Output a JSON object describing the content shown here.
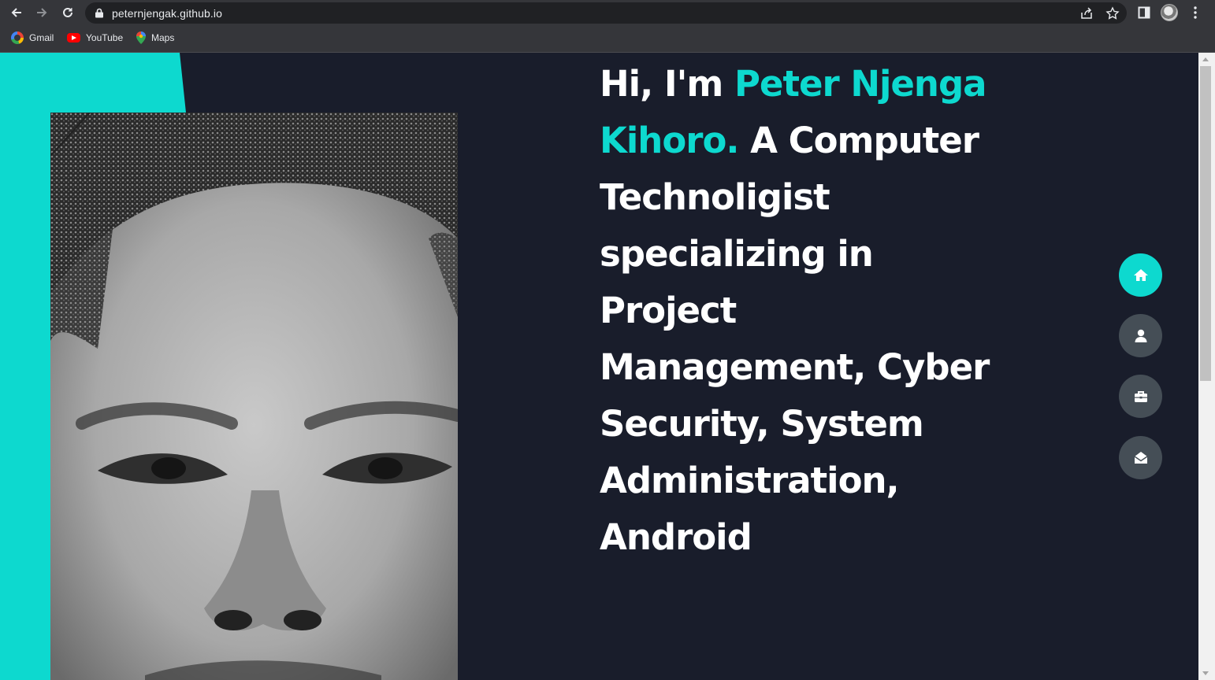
{
  "browser": {
    "url": "peternjengak.github.io",
    "bookmarks": [
      {
        "label": "Gmail",
        "icon": "google-icon"
      },
      {
        "label": "YouTube",
        "icon": "youtube-icon"
      },
      {
        "label": "Maps",
        "icon": "maps-icon"
      }
    ]
  },
  "hero": {
    "greeting": "Hi, I'm ",
    "name": "Peter Njenga Kihoro.",
    "tagline": " A Computer Technoligist specializing in Project Management, Cyber Security, System Administration, Android"
  },
  "side_nav": [
    {
      "icon": "home-icon",
      "active": true
    },
    {
      "icon": "user-icon",
      "active": false
    },
    {
      "icon": "briefcase-icon",
      "active": false
    },
    {
      "icon": "envelope-open-icon",
      "active": false
    }
  ],
  "colors": {
    "accent": "#0dd9cf",
    "background": "#191d2b",
    "nav_inactive": "#454e56",
    "text": "#ffffff"
  }
}
